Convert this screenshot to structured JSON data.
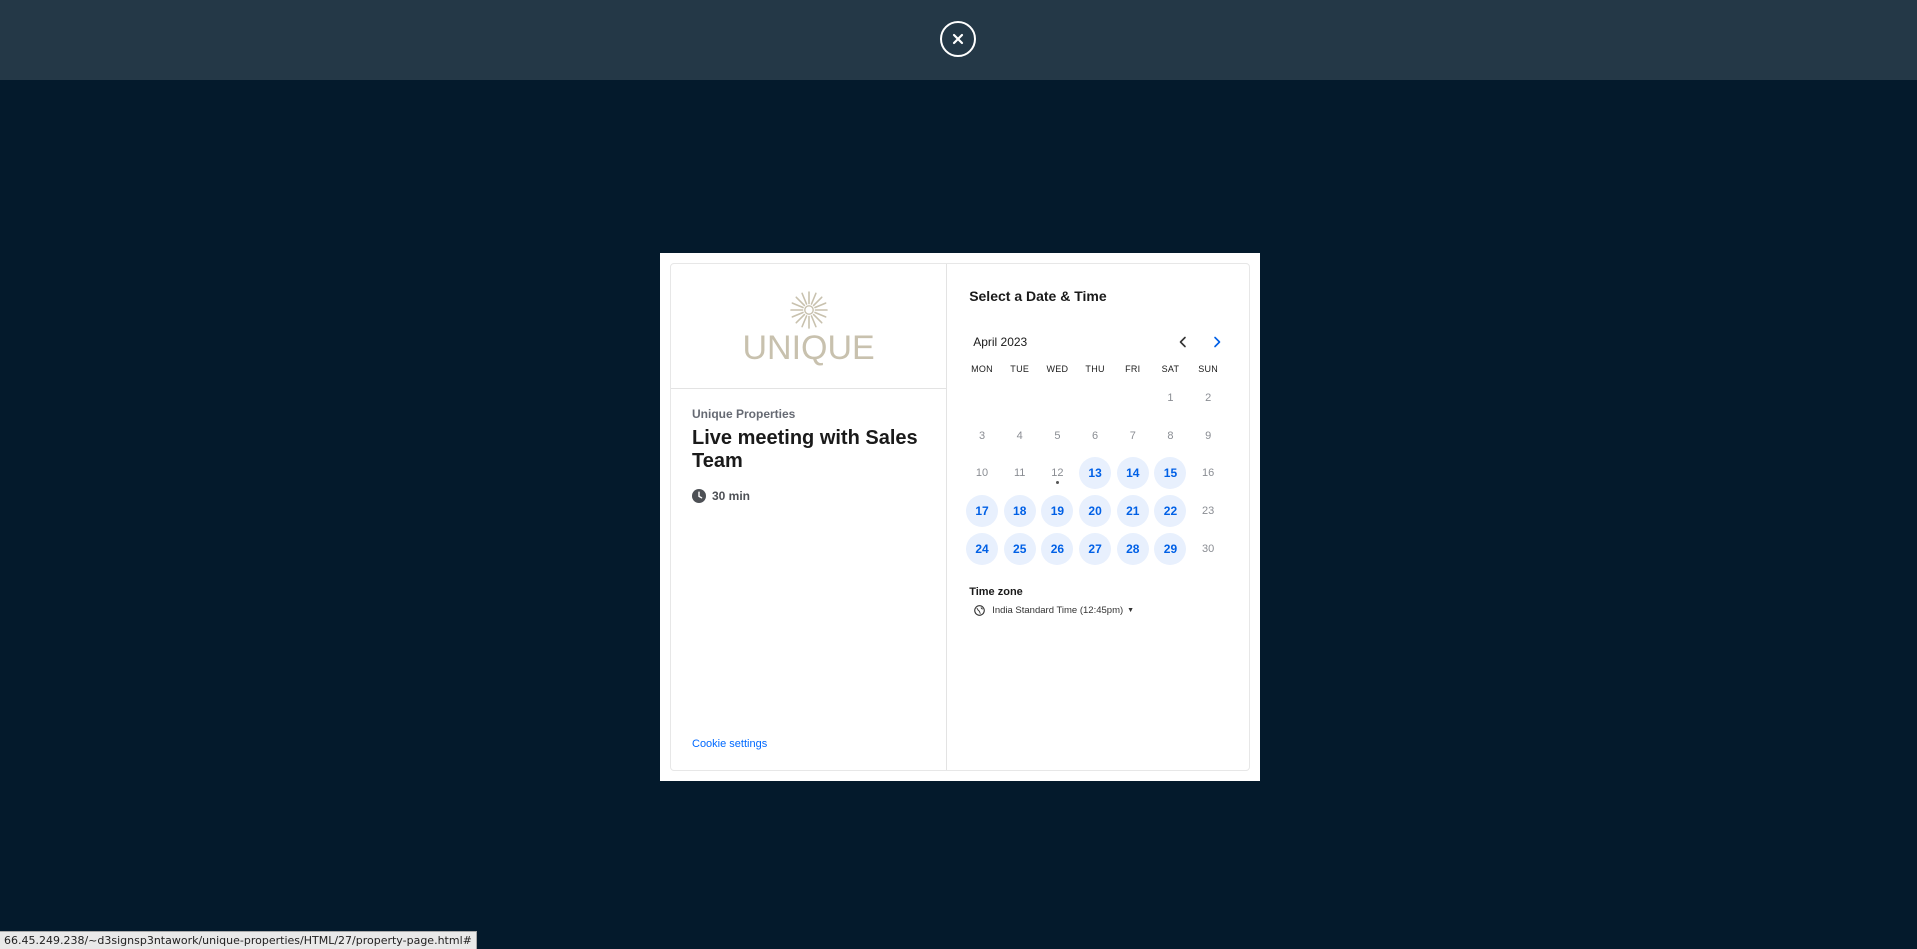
{
  "overlay": {
    "close_label": "×"
  },
  "brand": {
    "logo_text": "UNIQUE"
  },
  "event": {
    "organizer": "Unique Properties",
    "title": "Live meeting with Sales Team",
    "duration": "30 min"
  },
  "footer": {
    "cookie_settings": "Cookie settings"
  },
  "scheduler": {
    "heading": "Select a Date & Time",
    "month": "April 2023",
    "weekdays": [
      "MON",
      "TUE",
      "WED",
      "THU",
      "FRI",
      "SAT",
      "SUN"
    ],
    "days": [
      {
        "label": "",
        "available": false
      },
      {
        "label": "",
        "available": false
      },
      {
        "label": "",
        "available": false
      },
      {
        "label": "",
        "available": false
      },
      {
        "label": "",
        "available": false
      },
      {
        "label": "1",
        "available": false
      },
      {
        "label": "2",
        "available": false
      },
      {
        "label": "3",
        "available": false
      },
      {
        "label": "4",
        "available": false
      },
      {
        "label": "5",
        "available": false
      },
      {
        "label": "6",
        "available": false
      },
      {
        "label": "7",
        "available": false
      },
      {
        "label": "8",
        "available": false
      },
      {
        "label": "9",
        "available": false
      },
      {
        "label": "10",
        "available": false
      },
      {
        "label": "11",
        "available": false
      },
      {
        "label": "12",
        "available": false,
        "today": true
      },
      {
        "label": "13",
        "available": true
      },
      {
        "label": "14",
        "available": true
      },
      {
        "label": "15",
        "available": true
      },
      {
        "label": "16",
        "available": false
      },
      {
        "label": "17",
        "available": true
      },
      {
        "label": "18",
        "available": true
      },
      {
        "label": "19",
        "available": true
      },
      {
        "label": "20",
        "available": true
      },
      {
        "label": "21",
        "available": true
      },
      {
        "label": "22",
        "available": true
      },
      {
        "label": "23",
        "available": false
      },
      {
        "label": "24",
        "available": true
      },
      {
        "label": "25",
        "available": true
      },
      {
        "label": "26",
        "available": true
      },
      {
        "label": "27",
        "available": true
      },
      {
        "label": "28",
        "available": true
      },
      {
        "label": "29",
        "available": true
      },
      {
        "label": "30",
        "available": false
      }
    ],
    "timezone_label": "Time zone",
    "timezone_value": "India Standard Time (12:45pm)"
  },
  "status_bar": {
    "url": "66.45.249.238/~d3signsp3ntawork/unique-properties/HTML/27/property-page.html#"
  },
  "colors": {
    "page_bg": "#041a2c",
    "topbar_bg": "#243847",
    "accent": "#0060e6",
    "available_bg": "#e8f0fd",
    "logo": "#c8c1ae"
  }
}
